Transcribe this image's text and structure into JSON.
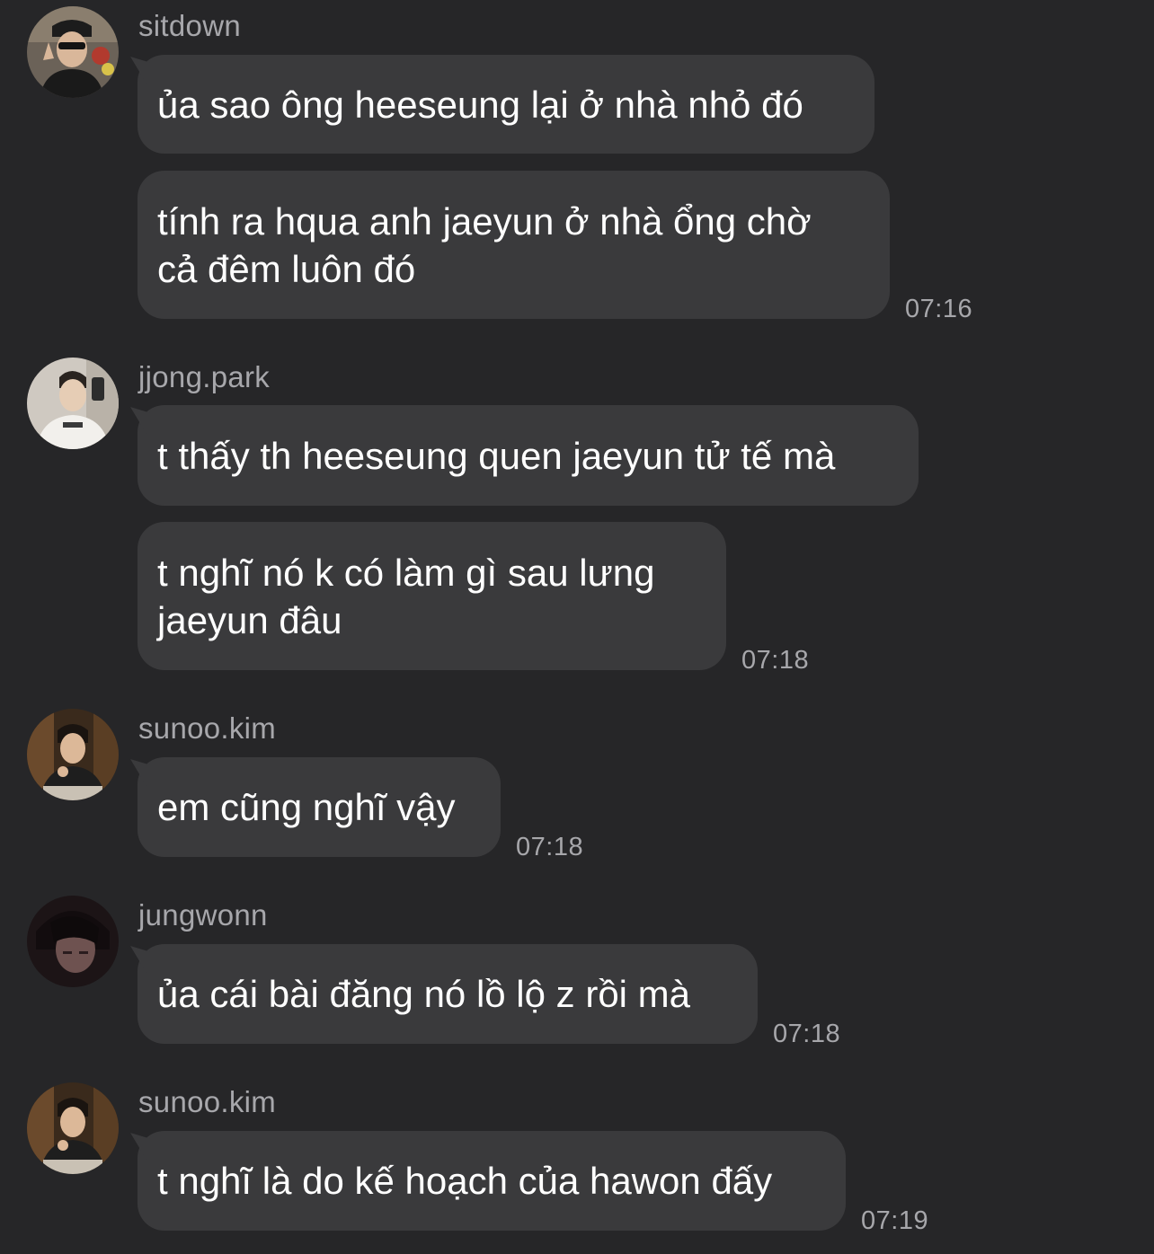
{
  "messages": [
    {
      "username": "sitdown",
      "avatar": "sitdown-avatar",
      "bubbles": [
        {
          "text": "ủa sao ông heeseung lại ở nhà nhỏ đó"
        },
        {
          "text": "tính ra hqua anh jaeyun ở nhà ổng chờ\ncả đêm luôn đó"
        }
      ],
      "time": "07:16"
    },
    {
      "username": "jjong.park",
      "avatar": "jjong-park-avatar",
      "bubbles": [
        {
          "text": "t thấy th heeseung quen jaeyun tử tế mà"
        },
        {
          "text": "t nghĩ nó k có làm gì sau lưng\njaeyun đâu"
        }
      ],
      "time": "07:18"
    },
    {
      "username": "sunoo.kim",
      "avatar": "sunoo-kim-avatar",
      "bubbles": [
        {
          "text": "em cũng nghĩ vậy"
        }
      ],
      "time": "07:18"
    },
    {
      "username": "jungwonn",
      "avatar": "jungwonn-avatar",
      "bubbles": [
        {
          "text": "ủa cái bài đăng nó lồ lộ z rồi mà"
        }
      ],
      "time": "07:18"
    },
    {
      "username": "sunoo.kim",
      "avatar": "sunoo-kim-avatar",
      "bubbles": [
        {
          "text": "t nghĩ là do kế hoạch của hawon đấy"
        }
      ],
      "time": "07:19"
    }
  ],
  "colors": {
    "background": "#262628",
    "bubble": "#3a3a3c",
    "meta_text": "#a7a7ab",
    "message_text": "#ffffff"
  }
}
